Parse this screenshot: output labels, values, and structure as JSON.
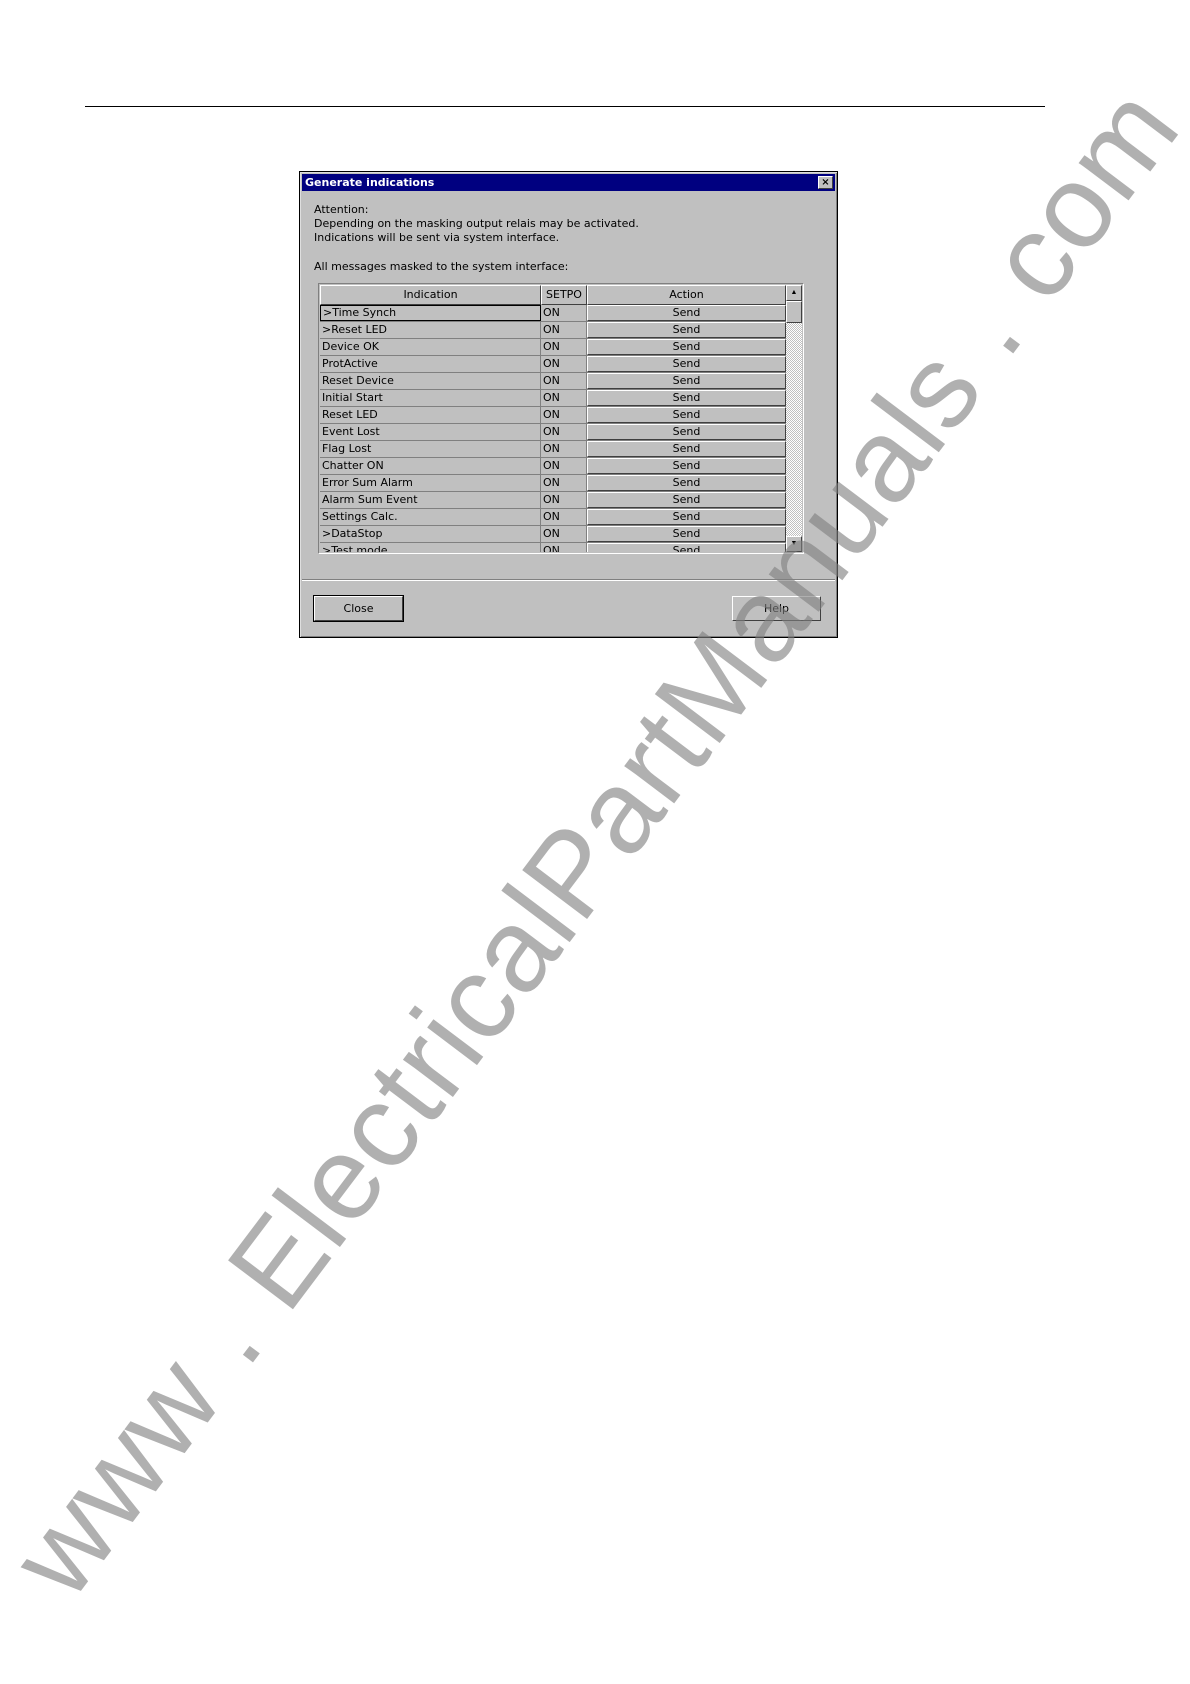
{
  "dialog": {
    "title": "Generate indications",
    "close_glyph": "×",
    "attention": "Attention:",
    "line1": "Depending on the masking output relais may be activated.",
    "line2": " Indications will be sent via system interface.",
    "list_caption": "All messages masked to the system interface:",
    "columns": [
      "Indication",
      "SETPO",
      "Action"
    ],
    "rows": [
      {
        "indication": ">Time Synch",
        "setpoint": "ON",
        "action": "Send"
      },
      {
        "indication": ">Reset LED",
        "setpoint": "ON",
        "action": "Send"
      },
      {
        "indication": "Device OK",
        "setpoint": "ON",
        "action": "Send"
      },
      {
        "indication": "ProtActive",
        "setpoint": "ON",
        "action": "Send"
      },
      {
        "indication": "Reset Device",
        "setpoint": "ON",
        "action": "Send"
      },
      {
        "indication": "Initial Start",
        "setpoint": "ON",
        "action": "Send"
      },
      {
        "indication": "Reset LED",
        "setpoint": "ON",
        "action": "Send"
      },
      {
        "indication": "Event Lost",
        "setpoint": "ON",
        "action": "Send"
      },
      {
        "indication": "Flag Lost",
        "setpoint": "ON",
        "action": "Send"
      },
      {
        "indication": "Chatter ON",
        "setpoint": "ON",
        "action": "Send"
      },
      {
        "indication": "Error Sum Alarm",
        "setpoint": "ON",
        "action": "Send"
      },
      {
        "indication": "Alarm Sum Event",
        "setpoint": "ON",
        "action": "Send"
      },
      {
        "indication": "Settings Calc.",
        "setpoint": "ON",
        "action": "Send"
      },
      {
        "indication": ">DataStop",
        "setpoint": "ON",
        "action": "Send"
      },
      {
        "indication": ">Test mode",
        "setpoint": "ON",
        "action": "Send"
      }
    ],
    "close_button": "Close",
    "help_button": "Help"
  },
  "watermark": "www . ElectricalPartManuals . com"
}
